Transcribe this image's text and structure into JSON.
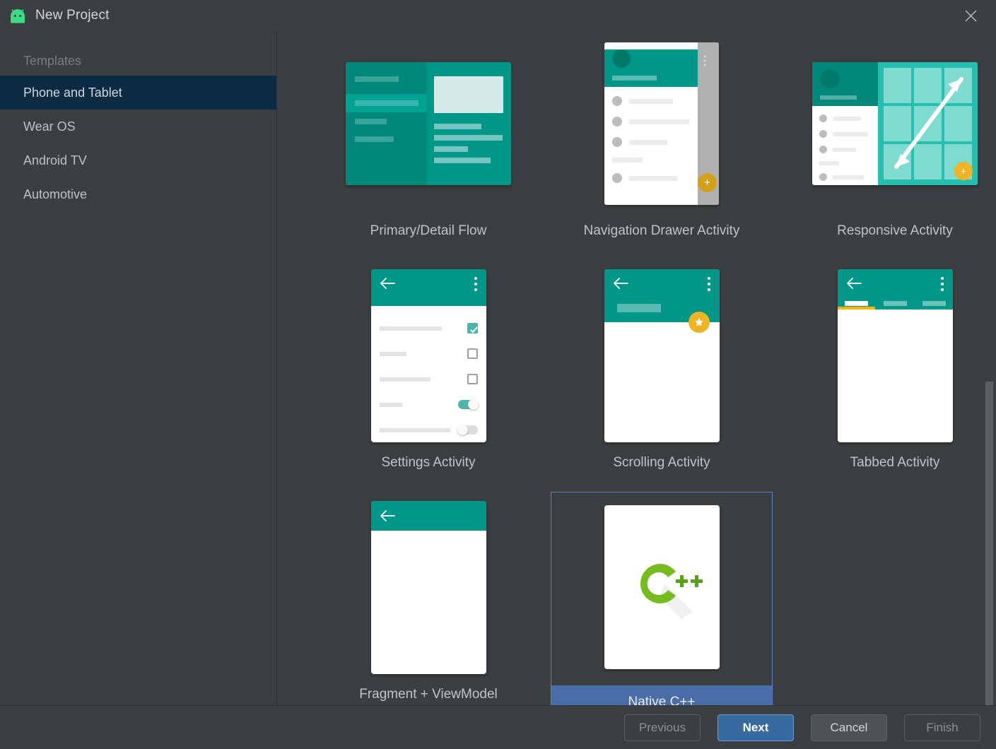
{
  "window": {
    "title": "New Project",
    "app_icon": "android-robot-icon",
    "close_icon": "close-icon"
  },
  "sidebar": {
    "header": "Templates",
    "items": [
      {
        "label": "Phone and Tablet",
        "selected": true
      },
      {
        "label": "Wear OS",
        "selected": false
      },
      {
        "label": "Android TV",
        "selected": false
      },
      {
        "label": "Automotive",
        "selected": false
      }
    ]
  },
  "templates": [
    {
      "label": "Primary/Detail Flow",
      "selected": false
    },
    {
      "label": "Navigation Drawer Activity",
      "selected": false
    },
    {
      "label": "Responsive Activity",
      "selected": false
    },
    {
      "label": "Settings Activity",
      "selected": false
    },
    {
      "label": "Scrolling Activity",
      "selected": false
    },
    {
      "label": "Tabbed Activity",
      "selected": false
    },
    {
      "label": "Fragment + ViewModel",
      "selected": false
    },
    {
      "label": "Native C++",
      "selected": true
    }
  ],
  "cpp_logo": {
    "letter": "C",
    "plus": "++"
  },
  "footer": {
    "previous": "Previous",
    "next": "Next",
    "cancel": "Cancel",
    "finish": "Finish"
  },
  "colors": {
    "dialog_background": "#3c3f41",
    "sidebar_selected": "#0d2c43",
    "selection_border": "#5781c4",
    "selection_label": "#4a6da7",
    "primary_button": "#376ba0",
    "material_teal": "#009688",
    "material_teal_dark": "#00796b",
    "fab_amber": "#f0b323",
    "tab_indicator": "#f5b700",
    "cpp_green": "#76bc21",
    "android_green": "#3ddc84",
    "scrollbar_thumb": "#5c5f61"
  },
  "scrollbar": {
    "thumb_top_pct": 52,
    "thumb_height_pct": 48
  }
}
